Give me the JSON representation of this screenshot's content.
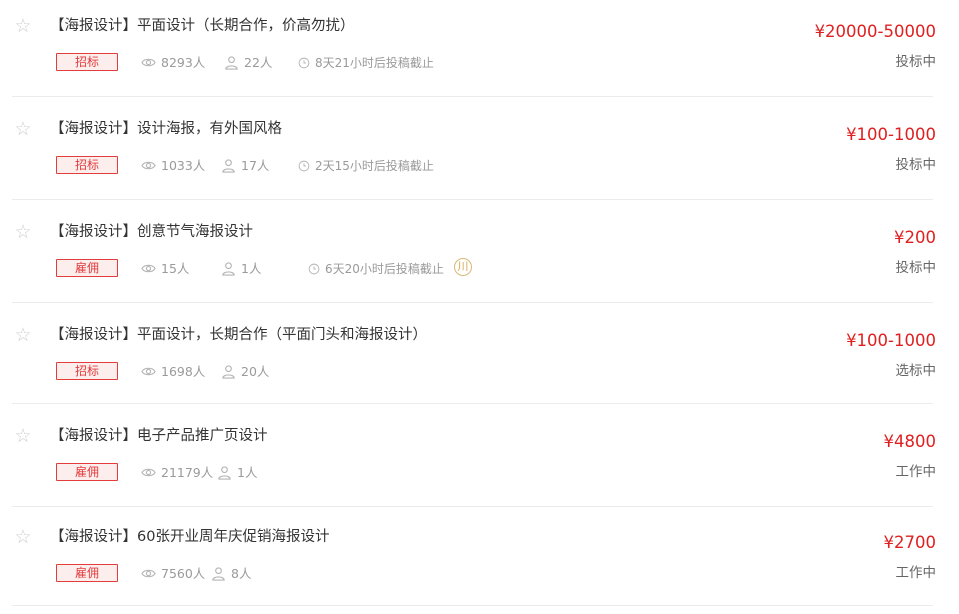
{
  "listings": [
    {
      "title": "【海报设计】平面设计（长期合作，价高勿扰）",
      "type": "招标",
      "views": "8293人",
      "participants": "22人",
      "deadline": "8天21小时后投稿截止",
      "price": "¥20000-50000",
      "status": "投标中"
    },
    {
      "title": "【海报设计】设计海报，有外国风格",
      "type": "招标",
      "views": "1033人",
      "participants": "17人",
      "deadline": "2天15小时后投稿截止",
      "price": "¥100-1000",
      "status": "投标中"
    },
    {
      "title": "【海报设计】创意节气海报设计",
      "type": "雇佣",
      "views": "15人",
      "participants": "1人",
      "deadline": "6天20小时后投稿截止",
      "tag_icon": "川",
      "price": "¥200",
      "status": "投标中"
    },
    {
      "title": "【海报设计】平面设计，长期合作（平面门头和海报设计）",
      "type": "招标",
      "views": "1698人",
      "participants": "20人",
      "price": "¥100-1000",
      "status": "选标中"
    },
    {
      "title": "【海报设计】电子产品推广页设计",
      "type": "雇佣",
      "views": "21179人",
      "participants": "1人",
      "price": "¥4800",
      "status": "工作中"
    },
    {
      "title": "【海报设计】60张开业周年庆促销海报设计",
      "type": "雇佣",
      "views": "7560人",
      "participants": "8人",
      "price": "¥2700",
      "status": "工作中"
    }
  ]
}
